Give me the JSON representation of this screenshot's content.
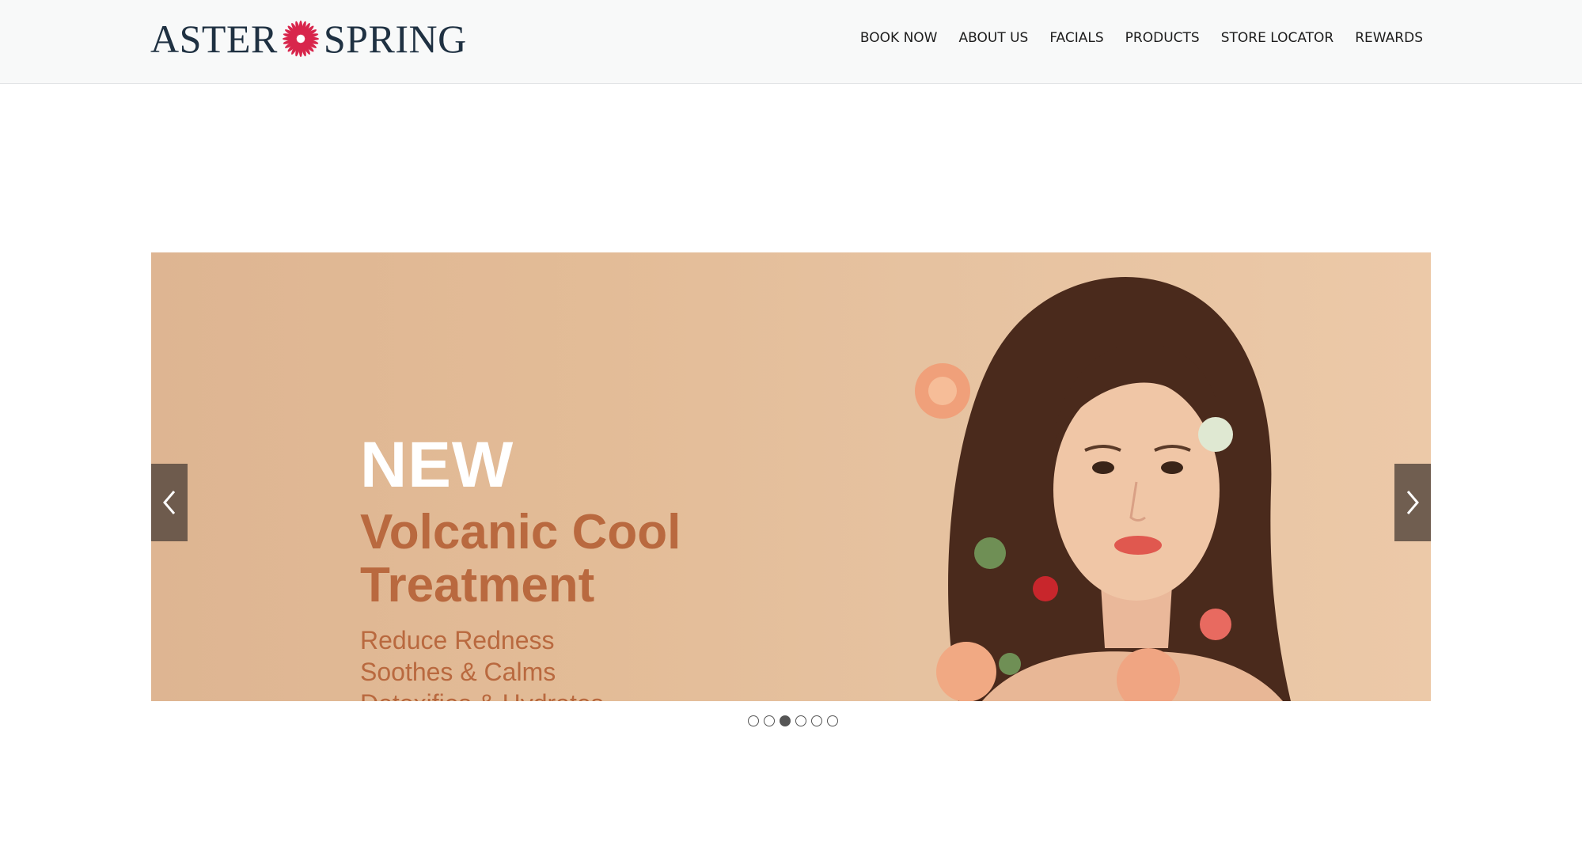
{
  "brand": {
    "name_left": "ASTER",
    "name_right": "SPRING",
    "logo_icon": "flower-icon",
    "logo_color": "#1f3142",
    "flower_color": "#d8264c"
  },
  "nav": {
    "items": [
      {
        "label": "BOOK NOW"
      },
      {
        "label": "ABOUT US"
      },
      {
        "label": "FACIALS"
      },
      {
        "label": "PRODUCTS"
      },
      {
        "label": "STORE LOCATOR"
      },
      {
        "label": "REWARDS"
      }
    ]
  },
  "hero": {
    "badge": "NEW",
    "title_line1": "Volcanic Cool",
    "title_line2": "Treatment",
    "benefits": [
      "Reduce Redness",
      "Soothes & Calms",
      "Detoxifies & Hydrates"
    ],
    "accent_color": "#b9693f",
    "prev_icon": "chevron-left-icon",
    "next_icon": "chevron-right-icon"
  },
  "carousel": {
    "slide_count": 6,
    "active_index": 2
  }
}
